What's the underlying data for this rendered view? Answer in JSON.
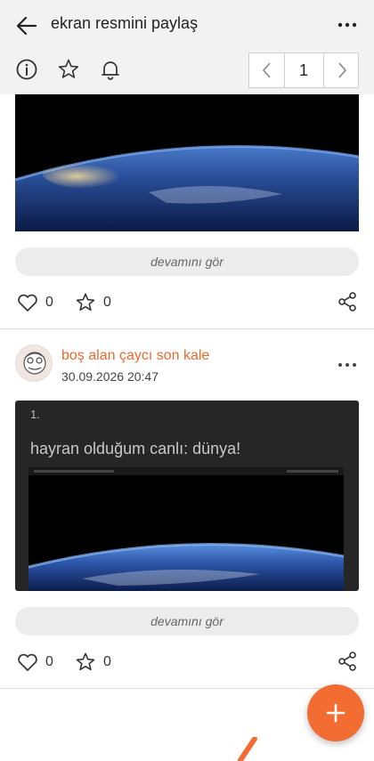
{
  "header": {
    "title": "ekran resmini paylaş",
    "page_number": "1"
  },
  "post1": {
    "see_more": "devamını gör",
    "likes": "0",
    "favorites": "0"
  },
  "post2": {
    "author": "boş alan çaycı son kale",
    "date": "30.09.2026 20:47",
    "image_number": "1.",
    "image_caption": "hayran olduğum canlı: dünya!",
    "see_more": "devamını gör",
    "likes": "0",
    "favorites": "0"
  },
  "colors": {
    "accent": "#f36d33",
    "author": "#e8692e",
    "header_bg": "#f2f2f2"
  }
}
